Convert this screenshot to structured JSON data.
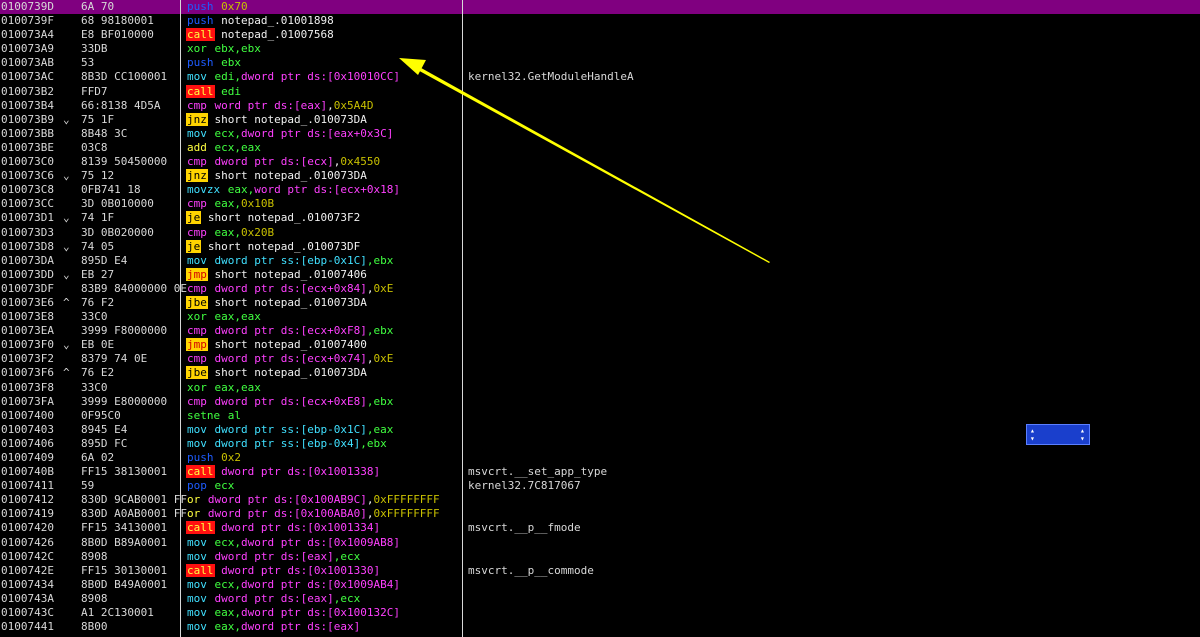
{
  "rows": [
    {
      "addr": "0100739D",
      "mark": "",
      "hex": "6A 70",
      "mn": "push",
      "mnType": "push",
      "ops": [
        {
          "t": "0x70",
          "c": "imm"
        }
      ],
      "comment": "",
      "selected": true
    },
    {
      "addr": "0100739F",
      "mark": "",
      "hex": "68 98180001",
      "mn": "push",
      "mnType": "push",
      "ops": [
        {
          "t": "notepad_.01001898",
          "c": "plain"
        }
      ],
      "comment": ""
    },
    {
      "addr": "010073A4",
      "mark": "",
      "hex": "E8 BF010000",
      "mn": "call",
      "mnType": "call",
      "ops": [
        {
          "t": "notepad_.01007568",
          "c": "plain"
        }
      ],
      "comment": ""
    },
    {
      "addr": "010073A9",
      "mark": "",
      "hex": "33DB",
      "mn": "xor",
      "mnType": "xor",
      "ops": [
        {
          "t": "ebx,ebx",
          "c": "reg"
        }
      ],
      "comment": ""
    },
    {
      "addr": "010073AB",
      "mark": "",
      "hex": "53",
      "mn": "push",
      "mnType": "push",
      "ops": [
        {
          "t": "ebx",
          "c": "reg"
        }
      ],
      "comment": ""
    },
    {
      "addr": "010073AC",
      "mark": "",
      "hex": "8B3D CC100001",
      "mn": "mov",
      "mnType": "mov",
      "ops": [
        {
          "t": "edi,",
          "c": "reg"
        },
        {
          "t": "dword ptr ds:[0x10010CC]",
          "c": "mem"
        }
      ],
      "comment": "kernel32.GetModuleHandleA"
    },
    {
      "addr": "010073B2",
      "mark": "",
      "hex": "FFD7",
      "mn": "call",
      "mnType": "call",
      "ops": [
        {
          "t": "edi",
          "c": "reg"
        }
      ],
      "comment": ""
    },
    {
      "addr": "010073B4",
      "mark": "",
      "hex": "66:8138 4D5A",
      "mn": "cmp",
      "mnType": "cmp",
      "ops": [
        {
          "t": "word ptr ds:[eax]",
          "c": "mem"
        },
        {
          "t": ",",
          "c": "plain"
        },
        {
          "t": "0x5A4D",
          "c": "imm"
        }
      ],
      "comment": ""
    },
    {
      "addr": "010073B9",
      "mark": "⌄",
      "hex": "75 1F",
      "mn": "jnz",
      "mnType": "jcc",
      "ops": [
        {
          "t": "short notepad_.010073DA",
          "c": "plain"
        }
      ],
      "comment": ""
    },
    {
      "addr": "010073BB",
      "mark": "",
      "hex": "8B48 3C",
      "mn": "mov",
      "mnType": "mov",
      "ops": [
        {
          "t": "ecx,",
          "c": "reg"
        },
        {
          "t": "dword ptr ds:[eax+0x3C]",
          "c": "mem"
        }
      ],
      "comment": ""
    },
    {
      "addr": "010073BE",
      "mark": "",
      "hex": "03C8",
      "mn": "add",
      "mnType": "add",
      "ops": [
        {
          "t": "ecx,eax",
          "c": "reg"
        }
      ],
      "comment": ""
    },
    {
      "addr": "010073C0",
      "mark": "",
      "hex": "8139 50450000",
      "mn": "cmp",
      "mnType": "cmp",
      "ops": [
        {
          "t": "dword ptr ds:[ecx]",
          "c": "mem"
        },
        {
          "t": ",",
          "c": "plain"
        },
        {
          "t": "0x4550",
          "c": "imm"
        }
      ],
      "comment": ""
    },
    {
      "addr": "010073C6",
      "mark": "⌄",
      "hex": "75 12",
      "mn": "jnz",
      "mnType": "jcc",
      "ops": [
        {
          "t": "short notepad_.010073DA",
          "c": "plain"
        }
      ],
      "comment": ""
    },
    {
      "addr": "010073C8",
      "mark": "",
      "hex": "0FB741 18",
      "mn": "movzx",
      "mnType": "mov",
      "ops": [
        {
          "t": "eax,",
          "c": "reg"
        },
        {
          "t": "word ptr ds:[ecx+0x18]",
          "c": "mem"
        }
      ],
      "comment": ""
    },
    {
      "addr": "010073CC",
      "mark": "",
      "hex": "3D 0B010000",
      "mn": "cmp",
      "mnType": "cmp",
      "ops": [
        {
          "t": "eax,",
          "c": "reg"
        },
        {
          "t": "0x10B",
          "c": "imm"
        }
      ],
      "comment": ""
    },
    {
      "addr": "010073D1",
      "mark": "⌄",
      "hex": "74 1F",
      "mn": "je",
      "mnType": "jcc",
      "ops": [
        {
          "t": "short notepad_.010073F2",
          "c": "plain"
        }
      ],
      "comment": ""
    },
    {
      "addr": "010073D3",
      "mark": "",
      "hex": "3D 0B020000",
      "mn": "cmp",
      "mnType": "cmp",
      "ops": [
        {
          "t": "eax,",
          "c": "reg"
        },
        {
          "t": "0x20B",
          "c": "imm"
        }
      ],
      "comment": ""
    },
    {
      "addr": "010073D8",
      "mark": "⌄",
      "hex": "74 05",
      "mn": "je",
      "mnType": "jcc",
      "ops": [
        {
          "t": "short notepad_.010073DF",
          "c": "plain"
        }
      ],
      "comment": ""
    },
    {
      "addr": "010073DA",
      "mark": "",
      "hex": "895D E4",
      "mn": "mov",
      "mnType": "mov",
      "ops": [
        {
          "t": "dword ptr ss:[ebp-0x1C]",
          "c": "mem2"
        },
        {
          "t": ",ebx",
          "c": "reg"
        }
      ],
      "comment": ""
    },
    {
      "addr": "010073DD",
      "mark": "⌄",
      "hex": "EB 27",
      "mn": "jmp",
      "mnType": "jmp",
      "ops": [
        {
          "t": "short notepad_.01007406",
          "c": "plain"
        }
      ],
      "comment": ""
    },
    {
      "addr": "010073DF",
      "mark": "",
      "hex": "83B9 84000000 0E",
      "mn": "cmp",
      "mnType": "cmp",
      "ops": [
        {
          "t": "dword ptr ds:[ecx+0x84]",
          "c": "mem"
        },
        {
          "t": ",",
          "c": "plain"
        },
        {
          "t": "0xE",
          "c": "imm"
        }
      ],
      "comment": ""
    },
    {
      "addr": "010073E6",
      "mark": "^",
      "hex": "76 F2",
      "mn": "jbe",
      "mnType": "jcc",
      "ops": [
        {
          "t": "short notepad_.010073DA",
          "c": "plain"
        }
      ],
      "comment": ""
    },
    {
      "addr": "010073E8",
      "mark": "",
      "hex": "33C0",
      "mn": "xor",
      "mnType": "xor",
      "ops": [
        {
          "t": "eax,eax",
          "c": "reg"
        }
      ],
      "comment": ""
    },
    {
      "addr": "010073EA",
      "mark": "",
      "hex": "3999 F8000000",
      "mn": "cmp",
      "mnType": "cmp",
      "ops": [
        {
          "t": "dword ptr ds:[ecx+0xF8]",
          "c": "mem"
        },
        {
          "t": ",ebx",
          "c": "reg"
        }
      ],
      "comment": ""
    },
    {
      "addr": "010073F0",
      "mark": "⌄",
      "hex": "EB 0E",
      "mn": "jmp",
      "mnType": "jmp",
      "ops": [
        {
          "t": "short notepad_.01007400",
          "c": "plain"
        }
      ],
      "comment": ""
    },
    {
      "addr": "010073F2",
      "mark": "",
      "hex": "8379 74 0E",
      "mn": "cmp",
      "mnType": "cmp",
      "ops": [
        {
          "t": "dword ptr ds:[ecx+0x74]",
          "c": "mem"
        },
        {
          "t": ",",
          "c": "plain"
        },
        {
          "t": "0xE",
          "c": "imm"
        }
      ],
      "comment": ""
    },
    {
      "addr": "010073F6",
      "mark": "^",
      "hex": "76 E2",
      "mn": "jbe",
      "mnType": "jcc",
      "ops": [
        {
          "t": "short notepad_.010073DA",
          "c": "plain"
        }
      ],
      "comment": ""
    },
    {
      "addr": "010073F8",
      "mark": "",
      "hex": "33C0",
      "mn": "xor",
      "mnType": "xor",
      "ops": [
        {
          "t": "eax,eax",
          "c": "reg"
        }
      ],
      "comment": ""
    },
    {
      "addr": "010073FA",
      "mark": "",
      "hex": "3999 E8000000",
      "mn": "cmp",
      "mnType": "cmp",
      "ops": [
        {
          "t": "dword ptr ds:[ecx+0xE8]",
          "c": "mem"
        },
        {
          "t": ",ebx",
          "c": "reg"
        }
      ],
      "comment": ""
    },
    {
      "addr": "01007400",
      "mark": "",
      "hex": "0F95C0",
      "mn": "setne",
      "mnType": "other",
      "ops": [
        {
          "t": "al",
          "c": "reg"
        }
      ],
      "comment": ""
    },
    {
      "addr": "01007403",
      "mark": "",
      "hex": "8945 E4",
      "mn": "mov",
      "mnType": "mov",
      "ops": [
        {
          "t": "dword ptr ss:[ebp-0x1C]",
          "c": "mem2"
        },
        {
          "t": ",eax",
          "c": "reg"
        }
      ],
      "comment": ""
    },
    {
      "addr": "01007406",
      "mark": "",
      "hex": "895D FC",
      "mn": "mov",
      "mnType": "mov",
      "ops": [
        {
          "t": "dword ptr ss:[ebp-0x4]",
          "c": "mem2"
        },
        {
          "t": ",ebx",
          "c": "reg"
        }
      ],
      "comment": ""
    },
    {
      "addr": "01007409",
      "mark": "",
      "hex": "6A 02",
      "mn": "push",
      "mnType": "push",
      "ops": [
        {
          "t": "0x2",
          "c": "imm"
        }
      ],
      "comment": ""
    },
    {
      "addr": "0100740B",
      "mark": "",
      "hex": "FF15 38130001",
      "mn": "call",
      "mnType": "call",
      "ops": [
        {
          "t": "dword ptr ds:[0x1001338]",
          "c": "mem"
        }
      ],
      "comment": "msvcrt.__set_app_type"
    },
    {
      "addr": "01007411",
      "mark": "",
      "hex": "59",
      "mn": "pop",
      "mnType": "push",
      "ops": [
        {
          "t": "ecx",
          "c": "reg"
        }
      ],
      "comment": "kernel32.7C817067"
    },
    {
      "addr": "01007412",
      "mark": "",
      "hex": "830D 9CAB0001 FF",
      "mn": "or",
      "mnType": "add",
      "ops": [
        {
          "t": "dword ptr ds:[0x100AB9C]",
          "c": "mem"
        },
        {
          "t": ",",
          "c": "plain"
        },
        {
          "t": "0xFFFFFFFF",
          "c": "imm"
        }
      ],
      "comment": ""
    },
    {
      "addr": "01007419",
      "mark": "",
      "hex": "830D A0AB0001 FF",
      "mn": "or",
      "mnType": "add",
      "ops": [
        {
          "t": "dword ptr ds:[0x100ABA0]",
          "c": "mem"
        },
        {
          "t": ",",
          "c": "plain"
        },
        {
          "t": "0xFFFFFFFF",
          "c": "imm"
        }
      ],
      "comment": ""
    },
    {
      "addr": "01007420",
      "mark": "",
      "hex": "FF15 34130001",
      "mn": "call",
      "mnType": "call",
      "ops": [
        {
          "t": "dword ptr ds:[0x1001334]",
          "c": "mem"
        }
      ],
      "comment": "msvcrt.__p__fmode"
    },
    {
      "addr": "01007426",
      "mark": "",
      "hex": "8B0D B89A0001",
      "mn": "mov",
      "mnType": "mov",
      "ops": [
        {
          "t": "ecx,",
          "c": "reg"
        },
        {
          "t": "dword ptr ds:[0x1009AB8]",
          "c": "mem"
        }
      ],
      "comment": ""
    },
    {
      "addr": "0100742C",
      "mark": "",
      "hex": "8908",
      "mn": "mov",
      "mnType": "mov",
      "ops": [
        {
          "t": "dword ptr ds:[eax]",
          "c": "mem"
        },
        {
          "t": ",ecx",
          "c": "reg"
        }
      ],
      "comment": ""
    },
    {
      "addr": "0100742E",
      "mark": "",
      "hex": "FF15 30130001",
      "mn": "call",
      "mnType": "call",
      "ops": [
        {
          "t": "dword ptr ds:[0x1001330]",
          "c": "mem"
        }
      ],
      "comment": "msvcrt.__p__commode"
    },
    {
      "addr": "01007434",
      "mark": "",
      "hex": "8B0D B49A0001",
      "mn": "mov",
      "mnType": "mov",
      "ops": [
        {
          "t": "ecx,",
          "c": "reg"
        },
        {
          "t": "dword ptr ds:[0x1009AB4]",
          "c": "mem"
        }
      ],
      "comment": ""
    },
    {
      "addr": "0100743A",
      "mark": "",
      "hex": "8908",
      "mn": "mov",
      "mnType": "mov",
      "ops": [
        {
          "t": "dword ptr ds:[eax]",
          "c": "mem"
        },
        {
          "t": ",ecx",
          "c": "reg"
        }
      ],
      "comment": ""
    },
    {
      "addr": "0100743C",
      "mark": "",
      "hex": "A1 2C130001",
      "mn": "mov",
      "mnType": "mov",
      "ops": [
        {
          "t": "eax,",
          "c": "reg"
        },
        {
          "t": "dword ptr ds:[0x100132C]",
          "c": "mem"
        }
      ],
      "comment": ""
    },
    {
      "addr": "01007441",
      "mark": "",
      "hex": "8B00",
      "mn": "mov",
      "mnType": "mov",
      "ops": [
        {
          "t": "eax,",
          "c": "reg"
        },
        {
          "t": "dword ptr ds:[eax]",
          "c": "mem"
        }
      ],
      "comment": ""
    }
  ],
  "colors": {
    "background": "#000000",
    "selection": "#800080",
    "annotation_arrow": "#ffff00",
    "widget": "#1a3fcc"
  },
  "icons": {
    "annotation": "arrow-annotation-icon",
    "widget_tick_up": "chevron-up-icon",
    "widget_tick_down": "chevron-down-icon"
  }
}
